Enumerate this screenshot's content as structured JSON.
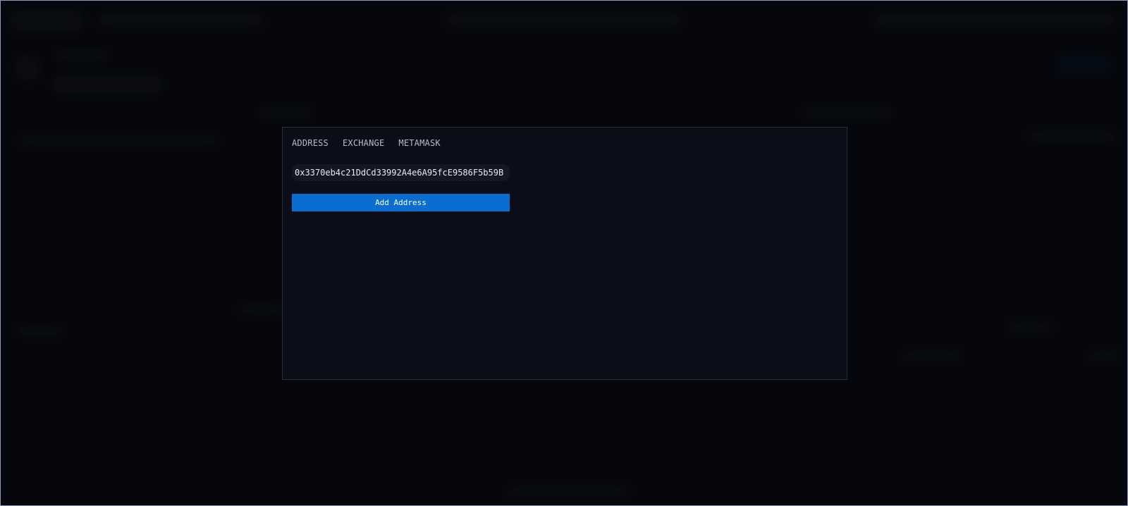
{
  "modal": {
    "tabs": [
      {
        "label": "ADDRESS"
      },
      {
        "label": "EXCHANGE"
      },
      {
        "label": "METAMASK"
      }
    ],
    "address_input": {
      "value": "0x3370eb4c21DdCd33992A4e6A95fcE9586F5b59B"
    },
    "add_button_label": "Add Address"
  },
  "colors": {
    "modal_background": "#0b0e18",
    "button_accent": "#0a6ed1",
    "tab_text": "#b8bcc6"
  }
}
